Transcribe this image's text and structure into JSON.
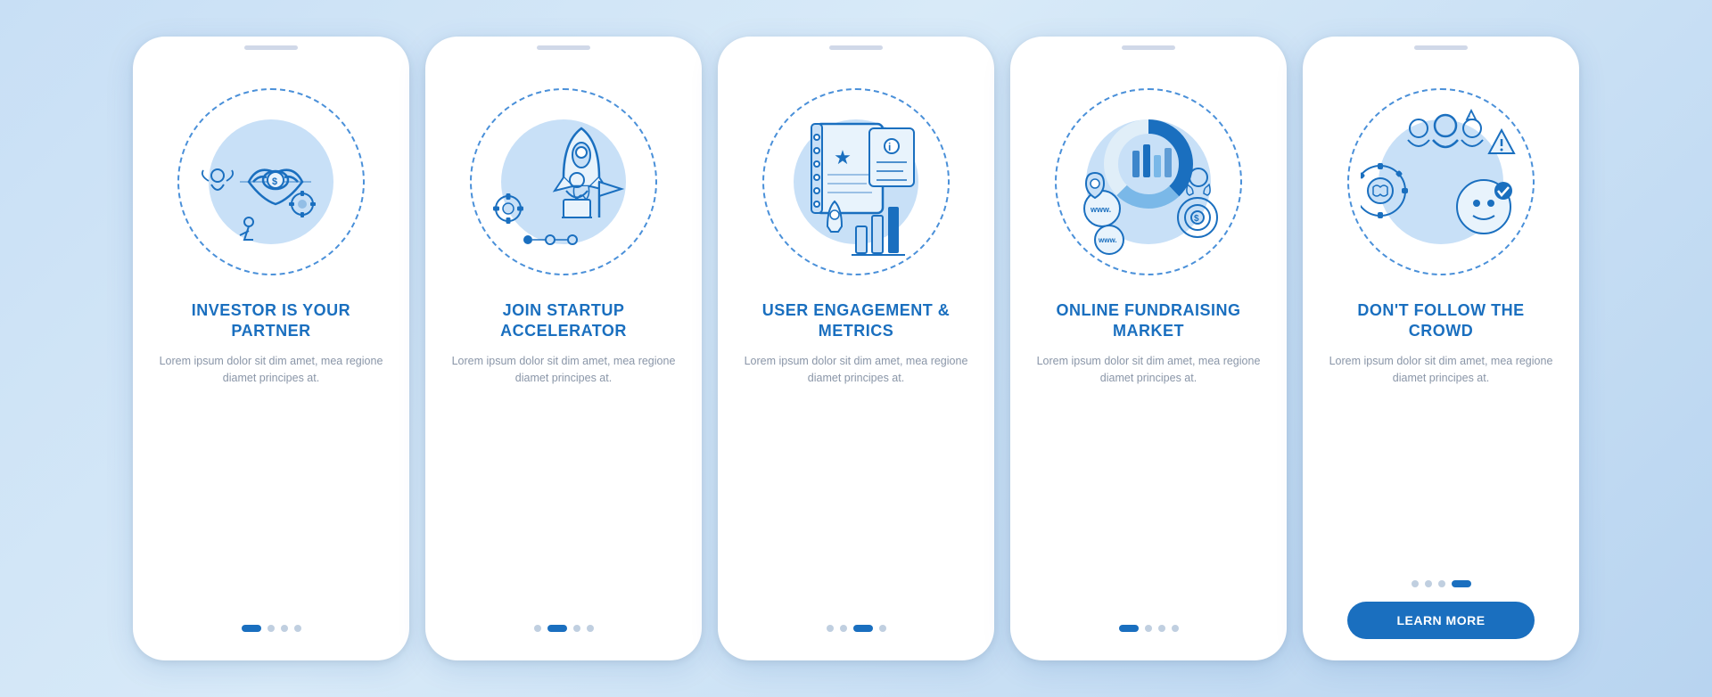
{
  "background": {
    "gradient_start": "#c8dff5",
    "gradient_end": "#b8d4f0"
  },
  "cards": [
    {
      "id": "card-1",
      "title": "INVESTOR IS YOUR PARTNER",
      "description": "Lorem ipsum dolor sit dim amet, mea regione diamet principes at.",
      "dots": [
        true,
        false,
        false,
        false
      ],
      "active_dot": 0,
      "show_button": false,
      "button_label": ""
    },
    {
      "id": "card-2",
      "title": "JOIN STARTUP ACCELERATOR",
      "description": "Lorem ipsum dolor sit dim amet, mea regione diamet principes at.",
      "dots": [
        false,
        true,
        false,
        false
      ],
      "active_dot": 1,
      "show_button": false,
      "button_label": ""
    },
    {
      "id": "card-3",
      "title": "USER ENGAGEMENT & METRICS",
      "description": "Lorem ipsum dolor sit dim amet, mea regione diamet principes at.",
      "dots": [
        false,
        false,
        true,
        false
      ],
      "active_dot": 2,
      "show_button": false,
      "button_label": ""
    },
    {
      "id": "card-4",
      "title": "ONLINE FUNDRAISING MARKET",
      "description": "Lorem ipsum dolor sit dim amet, mea regione diamet principes at.",
      "dots": [
        false,
        false,
        false,
        false
      ],
      "active_dot": 0,
      "show_button": false,
      "button_label": ""
    },
    {
      "id": "card-5",
      "title": "DON'T FOLLOW THE CROWD",
      "description": "Lorem ipsum dolor sit dim amet, mea regione diamet principes at.",
      "dots": [
        false,
        false,
        false,
        true
      ],
      "active_dot": 3,
      "show_button": true,
      "button_label": "LEARN MORE"
    }
  ]
}
